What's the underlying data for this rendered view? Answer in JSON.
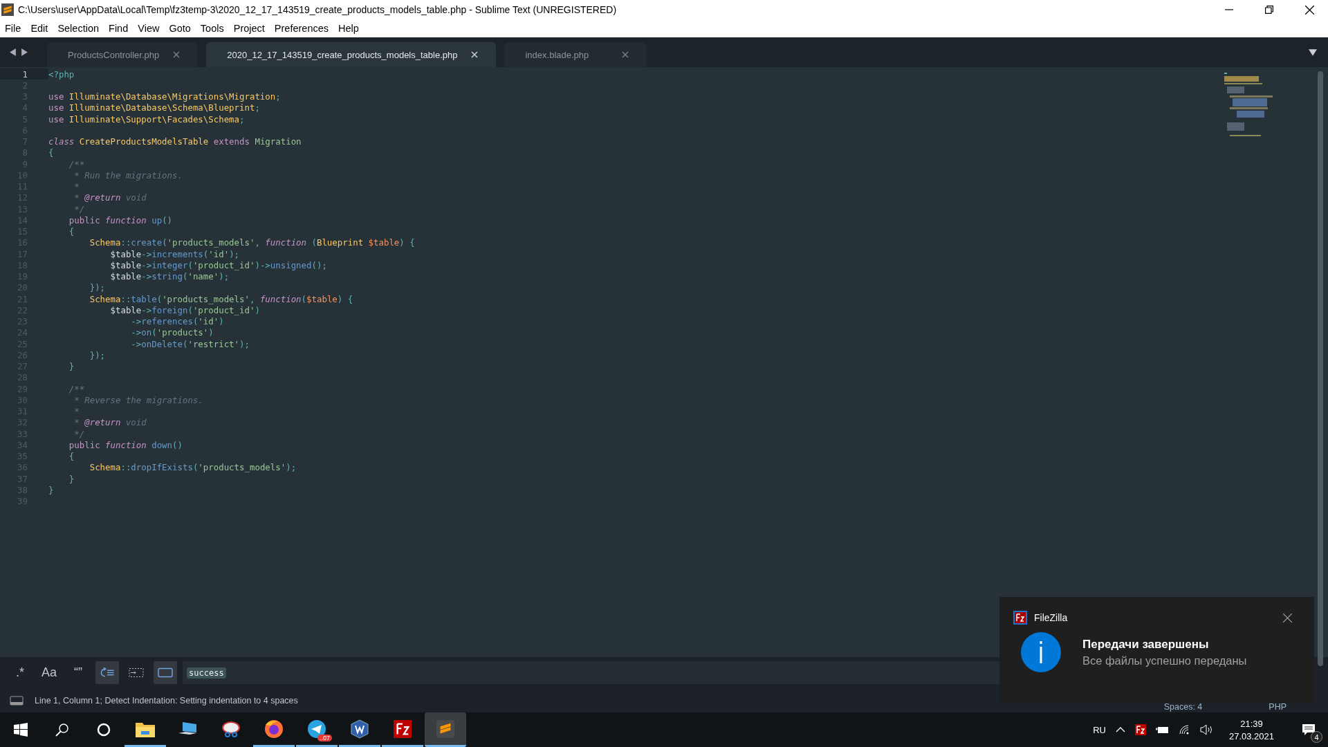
{
  "window": {
    "title": "C:\\Users\\user\\AppData\\Local\\Temp\\fz3temp-3\\2020_12_17_143519_create_products_models_table.php - Sublime Text (UNREGISTERED)"
  },
  "menu": [
    "File",
    "Edit",
    "Selection",
    "Find",
    "View",
    "Goto",
    "Tools",
    "Project",
    "Preferences",
    "Help"
  ],
  "tabs": [
    {
      "label": "ProductsController.php",
      "selected": false
    },
    {
      "label": "2020_12_17_143519_create_products_models_table.php",
      "selected": true
    },
    {
      "label": "index.blade.php",
      "selected": false
    }
  ],
  "lines": [
    {
      "number": "1",
      "current": true,
      "tokens": [
        {
          "kind": "tag",
          "text": "<?php"
        }
      ]
    },
    {
      "number": "2",
      "current": false
    },
    {
      "number": "3",
      "current": false,
      "tokens": [
        {
          "kind": "kw",
          "text": "use "
        },
        {
          "kind": "cls",
          "text": "Illuminate\\Database\\Migrations\\Migration"
        },
        {
          "kind": "p",
          "text": ";"
        }
      ]
    },
    {
      "number": "4",
      "current": false,
      "tokens": [
        {
          "kind": "kw",
          "text": "use "
        },
        {
          "kind": "cls",
          "text": "Illuminate\\Database\\Schema\\Blueprint"
        },
        {
          "kind": "p",
          "text": ";"
        }
      ]
    },
    {
      "number": "5",
      "current": false,
      "tokens": [
        {
          "kind": "kw",
          "text": "use "
        },
        {
          "kind": "cls",
          "text": "Illuminate\\Support\\Facades\\Schema"
        },
        {
          "kind": "p",
          "text": ";"
        }
      ]
    },
    {
      "number": "6",
      "current": false
    },
    {
      "number": "7",
      "current": false,
      "tokens": [
        {
          "kind": "st",
          "text": "class "
        },
        {
          "kind": "cls",
          "text": "CreateProductsModelsTable "
        },
        {
          "kind": "kw",
          "text": "extends "
        },
        {
          "kind": "inh",
          "text": "Migration"
        }
      ]
    },
    {
      "number": "8",
      "current": false,
      "tokens": [
        {
          "kind": "p",
          "text": "{"
        }
      ]
    },
    {
      "number": "9",
      "current": false,
      "tokens": [
        {
          "kind": "cm",
          "text": "    /**"
        }
      ]
    },
    {
      "number": "10",
      "current": false,
      "tokens": [
        {
          "kind": "cm",
          "text": "     * Run the migrations."
        }
      ]
    },
    {
      "number": "11",
      "current": false,
      "tokens": [
        {
          "kind": "cm",
          "text": "     *"
        }
      ]
    },
    {
      "number": "12",
      "current": false,
      "tokens": [
        {
          "kind": "cm",
          "text": "     * "
        },
        {
          "kind": "doc",
          "text": "@return"
        },
        {
          "kind": "cm",
          "text": " void"
        }
      ]
    },
    {
      "number": "13",
      "current": false,
      "tokens": [
        {
          "kind": "cm",
          "text": "     */"
        }
      ]
    },
    {
      "number": "14",
      "current": false,
      "tokens": [
        {
          "kind": "kw",
          "text": "    public "
        },
        {
          "kind": "st",
          "text": "function "
        },
        {
          "kind": "fn",
          "text": "up"
        },
        {
          "kind": "p",
          "text": "()"
        }
      ]
    },
    {
      "number": "15",
      "current": false,
      "tokens": [
        {
          "kind": "p",
          "text": "    {"
        }
      ]
    },
    {
      "number": "16",
      "current": false,
      "tokens": [
        {
          "kind": "cls",
          "text": "        Schema"
        },
        {
          "kind": "p",
          "text": "::"
        },
        {
          "kind": "fn",
          "text": "create"
        },
        {
          "kind": "p",
          "text": "("
        },
        {
          "kind": "str",
          "text": "'products_models'"
        },
        {
          "kind": "p",
          "text": ", "
        },
        {
          "kind": "st",
          "text": "function "
        },
        {
          "kind": "p",
          "text": "("
        },
        {
          "kind": "cls",
          "text": "Blueprint "
        },
        {
          "kind": "prm",
          "text": "$table"
        },
        {
          "kind": "p",
          "text": ") {"
        }
      ]
    },
    {
      "number": "17",
      "current": false,
      "tokens": [
        {
          "kind": "var",
          "text": "            $table"
        },
        {
          "kind": "p",
          "text": "->"
        },
        {
          "kind": "fn",
          "text": "increments"
        },
        {
          "kind": "p",
          "text": "("
        },
        {
          "kind": "str",
          "text": "'id'"
        },
        {
          "kind": "p",
          "text": ");"
        }
      ]
    },
    {
      "number": "18",
      "current": false,
      "tokens": [
        {
          "kind": "var",
          "text": "            $table"
        },
        {
          "kind": "p",
          "text": "->"
        },
        {
          "kind": "fn",
          "text": "integer"
        },
        {
          "kind": "p",
          "text": "("
        },
        {
          "kind": "str",
          "text": "'product_id'"
        },
        {
          "kind": "p",
          "text": ")->"
        },
        {
          "kind": "fn",
          "text": "unsigned"
        },
        {
          "kind": "p",
          "text": "();"
        }
      ]
    },
    {
      "number": "19",
      "current": false,
      "tokens": [
        {
          "kind": "var",
          "text": "            $table"
        },
        {
          "kind": "p",
          "text": "->"
        },
        {
          "kind": "fn",
          "text": "string"
        },
        {
          "kind": "p",
          "text": "("
        },
        {
          "kind": "str",
          "text": "'name'"
        },
        {
          "kind": "p",
          "text": ");"
        }
      ]
    },
    {
      "number": "20",
      "current": false,
      "tokens": [
        {
          "kind": "p",
          "text": "        });"
        }
      ]
    },
    {
      "number": "21",
      "current": false,
      "tokens": [
        {
          "kind": "cls",
          "text": "        Schema"
        },
        {
          "kind": "p",
          "text": "::"
        },
        {
          "kind": "fn",
          "text": "table"
        },
        {
          "kind": "p",
          "text": "("
        },
        {
          "kind": "str",
          "text": "'products_models'"
        },
        {
          "kind": "p",
          "text": ", "
        },
        {
          "kind": "st",
          "text": "function"
        },
        {
          "kind": "p",
          "text": "("
        },
        {
          "kind": "prm",
          "text": "$table"
        },
        {
          "kind": "p",
          "text": ") {"
        }
      ]
    },
    {
      "number": "22",
      "current": false,
      "tokens": [
        {
          "kind": "var",
          "text": "            $table"
        },
        {
          "kind": "p",
          "text": "->"
        },
        {
          "kind": "fn",
          "text": "foreign"
        },
        {
          "kind": "p",
          "text": "("
        },
        {
          "kind": "str",
          "text": "'product_id'"
        },
        {
          "kind": "p",
          "text": ")"
        }
      ]
    },
    {
      "number": "23",
      "current": false,
      "tokens": [
        {
          "kind": "p",
          "text": "                ->"
        },
        {
          "kind": "fn",
          "text": "references"
        },
        {
          "kind": "p",
          "text": "("
        },
        {
          "kind": "str",
          "text": "'id'"
        },
        {
          "kind": "p",
          "text": ")"
        }
      ]
    },
    {
      "number": "24",
      "current": false,
      "tokens": [
        {
          "kind": "p",
          "text": "                ->"
        },
        {
          "kind": "fn",
          "text": "on"
        },
        {
          "kind": "p",
          "text": "("
        },
        {
          "kind": "str",
          "text": "'products'"
        },
        {
          "kind": "p",
          "text": ")"
        }
      ]
    },
    {
      "number": "25",
      "current": false,
      "tokens": [
        {
          "kind": "p",
          "text": "                ->"
        },
        {
          "kind": "fn",
          "text": "onDelete"
        },
        {
          "kind": "p",
          "text": "("
        },
        {
          "kind": "str",
          "text": "'restrict'"
        },
        {
          "kind": "p",
          "text": ");"
        }
      ]
    },
    {
      "number": "26",
      "current": false,
      "tokens": [
        {
          "kind": "p",
          "text": "        });"
        }
      ]
    },
    {
      "number": "27",
      "current": false,
      "tokens": [
        {
          "kind": "p",
          "text": "    }"
        }
      ]
    },
    {
      "number": "28",
      "current": false
    },
    {
      "number": "29",
      "current": false,
      "tokens": [
        {
          "kind": "cm",
          "text": "    /**"
        }
      ]
    },
    {
      "number": "30",
      "current": false,
      "tokens": [
        {
          "kind": "cm",
          "text": "     * Reverse the migrations."
        }
      ]
    },
    {
      "number": "31",
      "current": false,
      "tokens": [
        {
          "kind": "cm",
          "text": "     *"
        }
      ]
    },
    {
      "number": "32",
      "current": false,
      "tokens": [
        {
          "kind": "cm",
          "text": "     * "
        },
        {
          "kind": "doc",
          "text": "@return"
        },
        {
          "kind": "cm",
          "text": " void"
        }
      ]
    },
    {
      "number": "33",
      "current": false,
      "tokens": [
        {
          "kind": "cm",
          "text": "     */"
        }
      ]
    },
    {
      "number": "34",
      "current": false,
      "tokens": [
        {
          "kind": "kw",
          "text": "    public "
        },
        {
          "kind": "st",
          "text": "function "
        },
        {
          "kind": "fn",
          "text": "down"
        },
        {
          "kind": "p",
          "text": "()"
        }
      ]
    },
    {
      "number": "35",
      "current": false,
      "tokens": [
        {
          "kind": "p",
          "text": "    {"
        }
      ]
    },
    {
      "number": "36",
      "current": false,
      "tokens": [
        {
          "kind": "cls",
          "text": "        Schema"
        },
        {
          "kind": "p",
          "text": "::"
        },
        {
          "kind": "fn",
          "text": "dropIfExists"
        },
        {
          "kind": "p",
          "text": "("
        },
        {
          "kind": "str",
          "text": "'products_models'"
        },
        {
          "kind": "p",
          "text": ");"
        }
      ]
    },
    {
      "number": "37",
      "current": false,
      "tokens": [
        {
          "kind": "p",
          "text": "    }"
        }
      ]
    },
    {
      "number": "38",
      "current": false,
      "tokens": [
        {
          "kind": "p",
          "text": "}"
        }
      ]
    },
    {
      "number": "39",
      "current": false
    }
  ],
  "find_bar": {
    "toggles": [
      {
        "kind": "text",
        "label": ".*",
        "on": false
      },
      {
        "kind": "text",
        "label": "Aa",
        "on": false
      },
      {
        "kind": "text",
        "label": "“”",
        "on": false
      },
      {
        "kind": "wrap",
        "on": true
      },
      {
        "kind": "selection",
        "on": false
      },
      {
        "kind": "highlight",
        "on": true
      }
    ],
    "value": "success"
  },
  "status_bar": {
    "message": "Line 1, Column 1; Detect Indentation: Setting indentation to 4 spaces",
    "indentation": "Spaces: 4",
    "syntax": "PHP"
  },
  "notification": {
    "app": "FileZilla",
    "title": "Передачи завершены",
    "body": "Все файлы успешно переданы"
  },
  "taskbar": {
    "apps": [
      {
        "kind": "folder",
        "running": true,
        "selected": false
      },
      {
        "kind": "computer",
        "running": false,
        "selected": false
      },
      {
        "kind": "snip",
        "running": false,
        "selected": false
      },
      {
        "kind": "firefox",
        "running": true,
        "selected": false
      },
      {
        "kind": "telegram",
        "running": true,
        "selected": false,
        "badge": "..07"
      },
      {
        "kind": "word",
        "running": true,
        "selected": false
      },
      {
        "kind": "filezilla",
        "running": true,
        "selected": false
      },
      {
        "kind": "sublime",
        "running": true,
        "selected": true
      }
    ],
    "language": "RU",
    "time": "21:39",
    "date": "27.03.2021",
    "notification_count": "4"
  }
}
